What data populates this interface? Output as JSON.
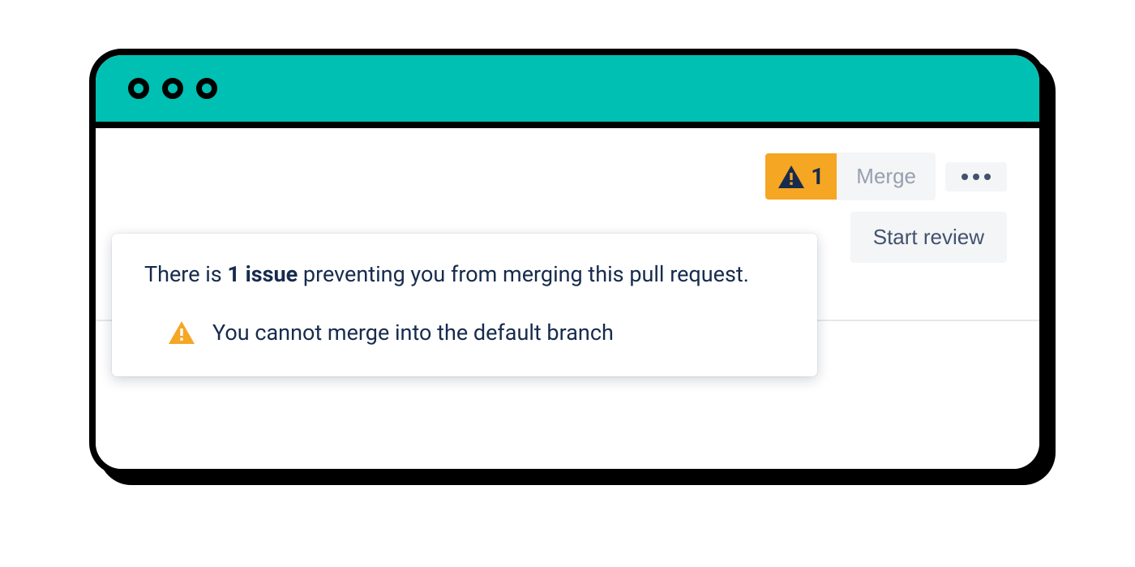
{
  "toolbar": {
    "warning_count": "1",
    "merge_label": "Merge",
    "start_review_label": "Start review"
  },
  "popover": {
    "heading_prefix": "There is ",
    "heading_bold": "1 issue",
    "heading_suffix": " preventing you from merging this pull request.",
    "issue_text": "You cannot merge into the default branch"
  }
}
